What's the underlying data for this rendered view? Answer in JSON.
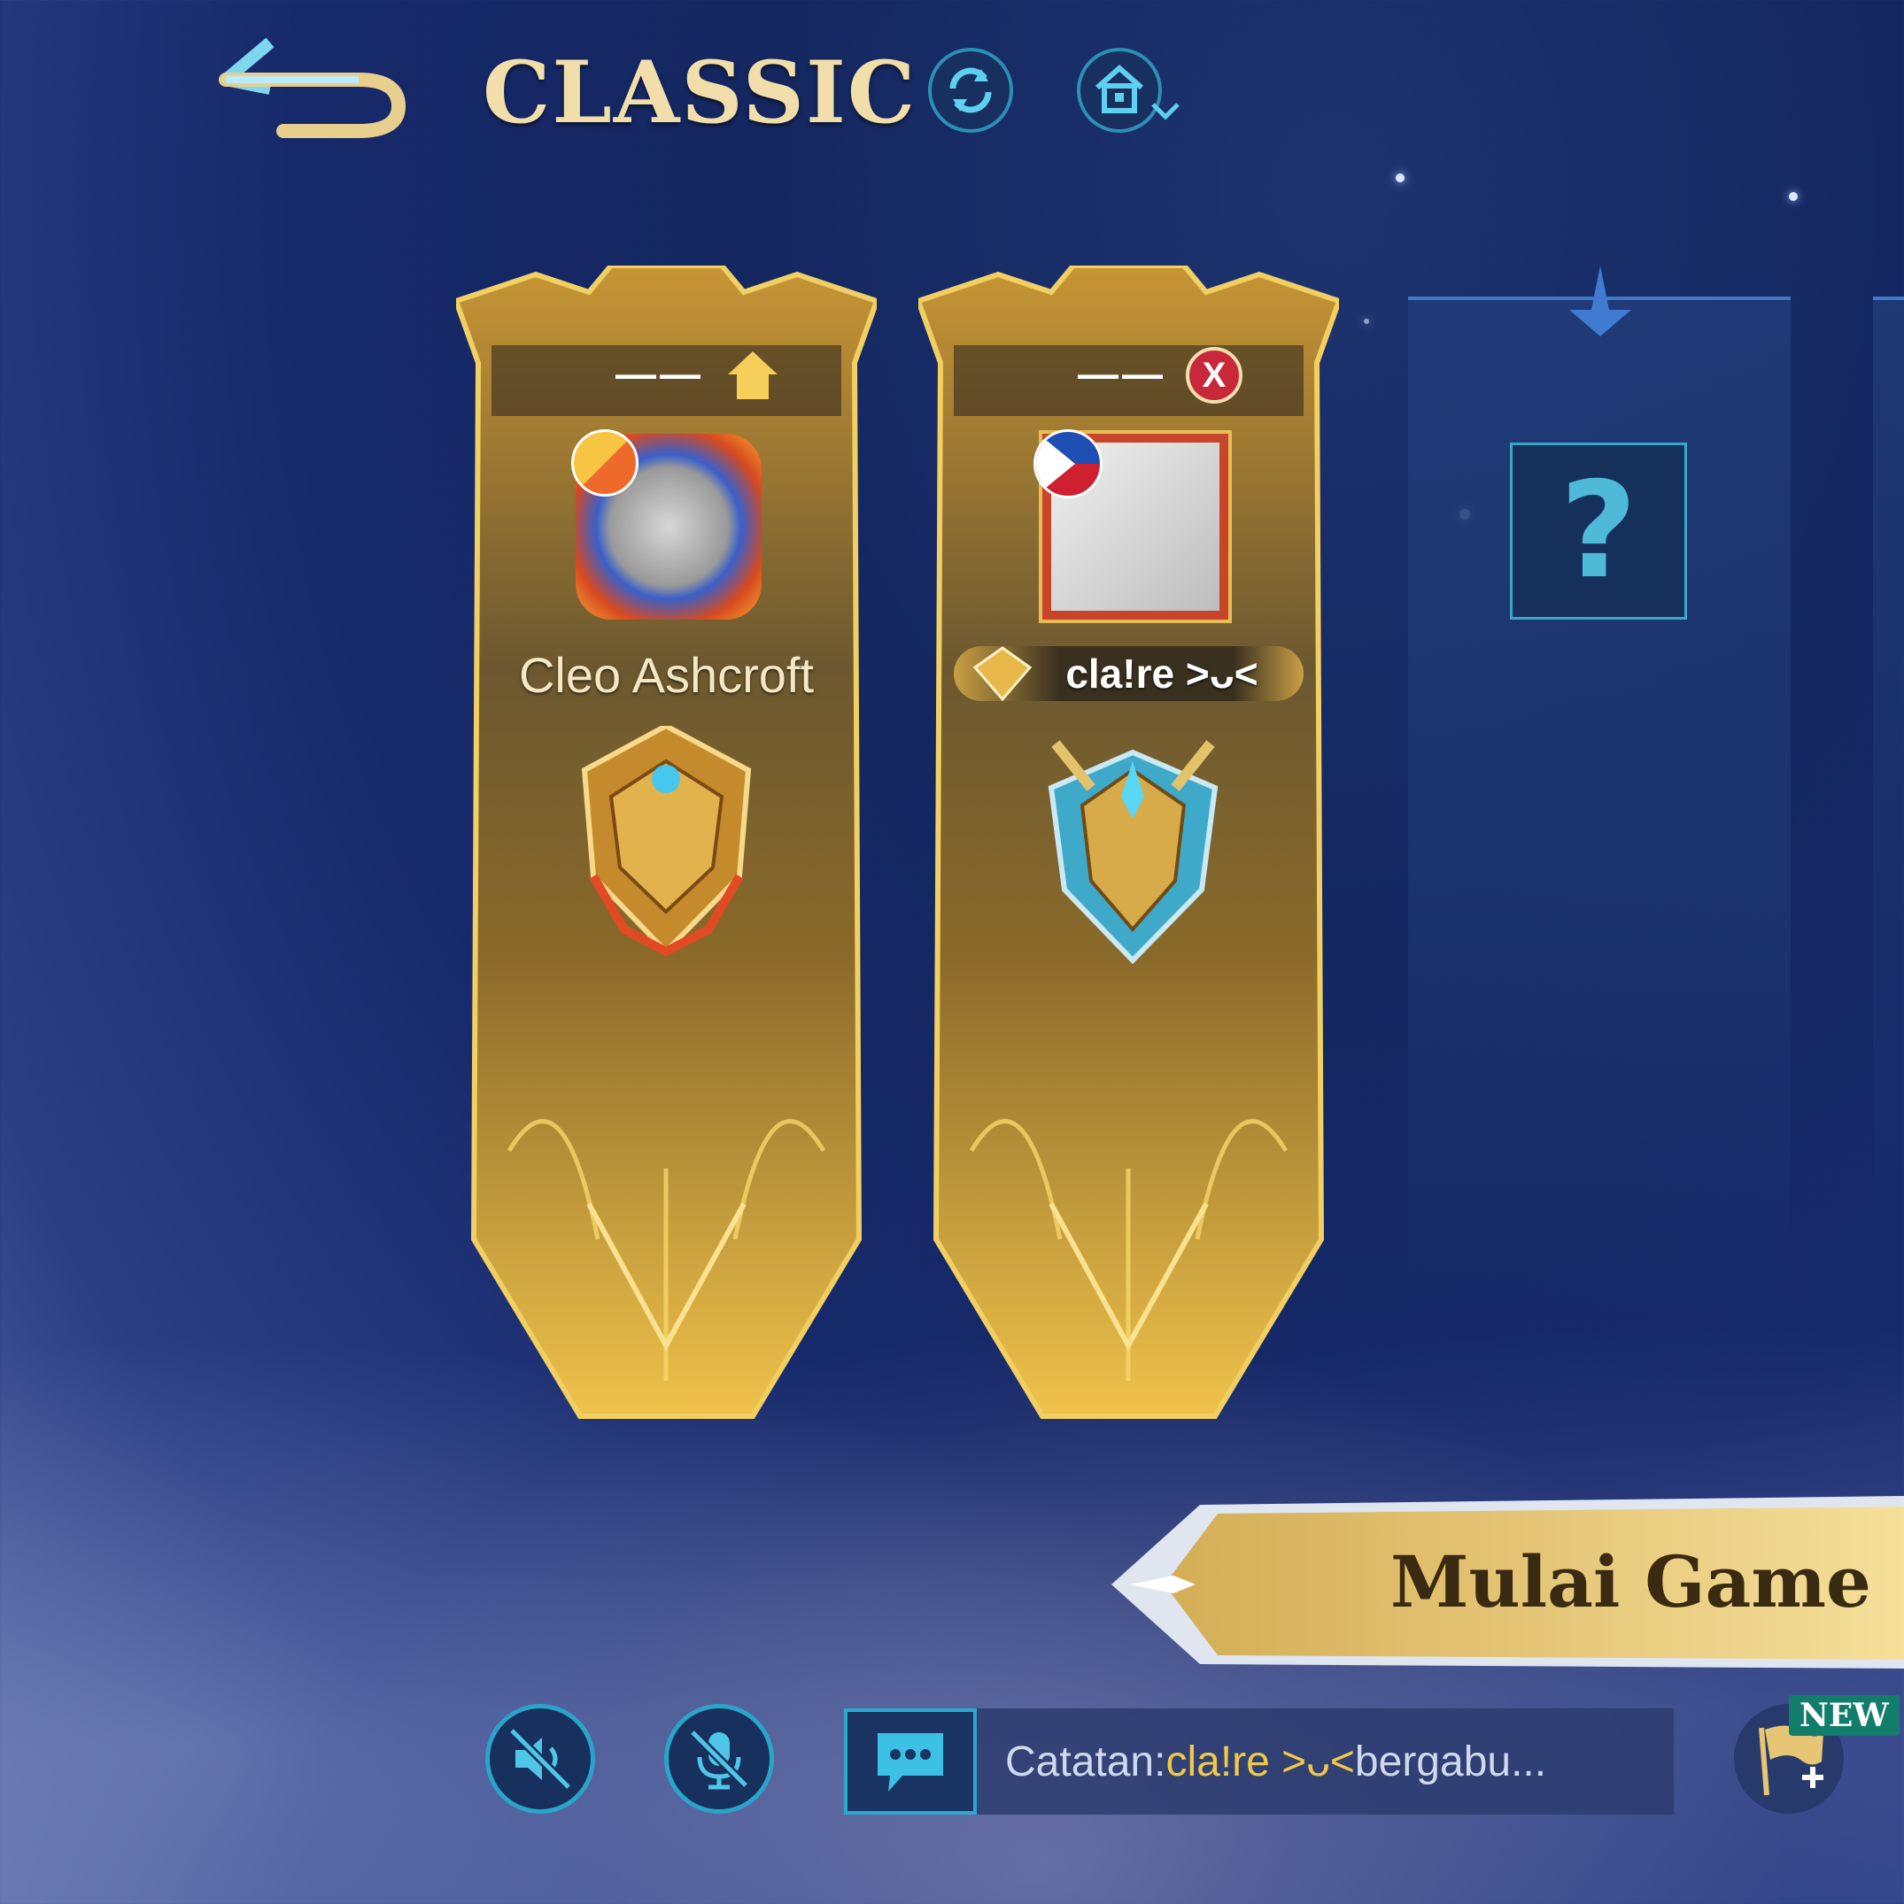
{
  "header": {
    "title": "CLASSIC"
  },
  "players": [
    {
      "slot_label": "——",
      "name": "Cleo Ashcroft",
      "role_icon": "home-icon"
    },
    {
      "slot_label": "——",
      "name": "cla!re >ᴗ<",
      "role_icon": "kick-icon",
      "kick_label": "X"
    }
  ],
  "empty_slot": {
    "label": "?"
  },
  "start_button": {
    "label": "Mulai Game"
  },
  "chat": {
    "prefix": "Catatan:",
    "player": "cla!re >ᴗ<",
    "suffix": " bergabu..."
  },
  "invite": {
    "badge": "NEW"
  },
  "colors": {
    "gold": "#d8a93a",
    "accent_cyan": "#29a5c9",
    "background": "#16296a"
  }
}
